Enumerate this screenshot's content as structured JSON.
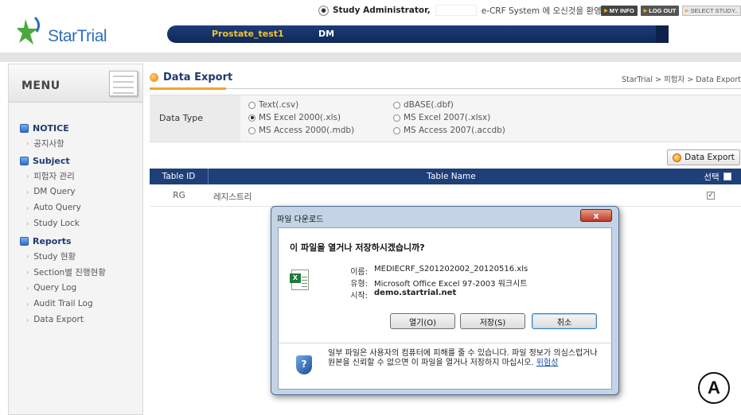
{
  "header": {
    "logo_text": "StarTrial",
    "user_name": "Study Administrator,",
    "welcome_text": "e-CRF System 에 오신것을 환영합니다.",
    "my_info": "MY INFO",
    "log_out": "LOG OUT",
    "select_study": "SELECT STUDY..",
    "study_name": "Prostate_test1",
    "module": "DM"
  },
  "sidebar": {
    "title": "MENU",
    "sections": [
      {
        "label": "NOTICE",
        "items": [
          "공지사항"
        ]
      },
      {
        "label": "Subject",
        "items": [
          "피험자 관리",
          "DM Query",
          "Auto Query",
          "Study Lock"
        ]
      },
      {
        "label": "Reports",
        "items": [
          "Study 현황",
          "Section별 진행현황",
          "Query Log",
          "Audit Trail Log",
          "Data Export"
        ]
      }
    ]
  },
  "main": {
    "title": "Data Export",
    "breadcrumb": "StarTrial > 피험자 > Data Export",
    "data_type_label": "Data Type",
    "options": [
      {
        "label": "Text(.csv)",
        "selected": false
      },
      {
        "label": "dBASE(.dbf)",
        "selected": false
      },
      {
        "label": "MS Excel 2000(.xls)",
        "selected": true
      },
      {
        "label": "MS Excel 2007(.xlsx)",
        "selected": false
      },
      {
        "label": "MS Access 2000(.mdb)",
        "selected": false
      },
      {
        "label": "MS Access 2007(.accdb)",
        "selected": false
      }
    ],
    "export_button": "Data Export",
    "table": {
      "headers": [
        "Table ID",
        "Table Name",
        "선택"
      ],
      "rows": [
        {
          "id": "RG",
          "name": "레지스트리",
          "checked": true
        }
      ]
    }
  },
  "dialog": {
    "title": "파일 다운로드",
    "close": "x",
    "question": "이 파일을 열거나 저장하시겠습니까?",
    "name_key": "이름:",
    "name_value": "MEDIECRF_S201202002_20120516.xls",
    "type_key": "유형:",
    "type_value": "Microsoft Office Excel 97-2003 워크시트",
    "from_key": "시작:",
    "from_value": "demo.startrial.net",
    "open_button": "열기(O)",
    "save_button": "저장(S)",
    "cancel_button": "취소",
    "warning_text": "일부 파일은 사용자의 컴퓨터에 피해를 줄 수 있습니다. 파일 정보가 의심스럽거나 원본을 신뢰할 수 없으면 이 파일을 열거나 저장하지 마십시오.",
    "warning_link": "위험성"
  },
  "badge": "A"
}
